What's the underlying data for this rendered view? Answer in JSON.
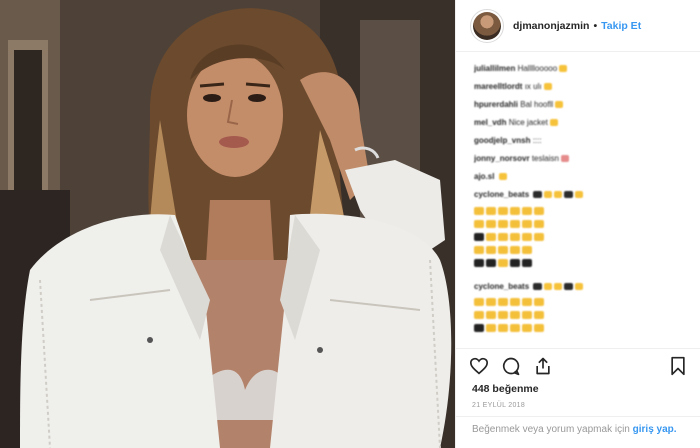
{
  "post": {
    "username": "djmanonjazmin",
    "separator": "•",
    "follow_label": "Takip Et",
    "likes": "448 beğenme",
    "date": "21 EYLÜL 2018",
    "login_prompt": "Beğenmek veya yorum yapmak için",
    "login_link": "giriş yap."
  },
  "comments": [
    {
      "user": "juliallilmen",
      "text": "Hallllooooo"
    },
    {
      "user": "mareelltlordt",
      "text": "ıx ulı"
    },
    {
      "user": "hpurerdahli",
      "text": "Bal hoofll"
    },
    {
      "user": "mel_vdh",
      "text": "Nice jacket"
    },
    {
      "user": "goodjelp_vnsh",
      "text": "::::"
    },
    {
      "user": "jonny_norsovr",
      "text": "teslaisn"
    },
    {
      "user": "ajo.sl",
      "text": ""
    },
    {
      "user": "cyclone_beats",
      "text": ""
    },
    {
      "user": "cyclone_beats",
      "text": ""
    }
  ],
  "icons": {
    "heart": "heart-icon",
    "comment": "comment-icon",
    "share": "share-icon",
    "bookmark": "bookmark-icon"
  },
  "colors": {
    "link": "#3897f0",
    "text": "#262626",
    "muted": "#999999",
    "emoji": "#f6c23a"
  }
}
